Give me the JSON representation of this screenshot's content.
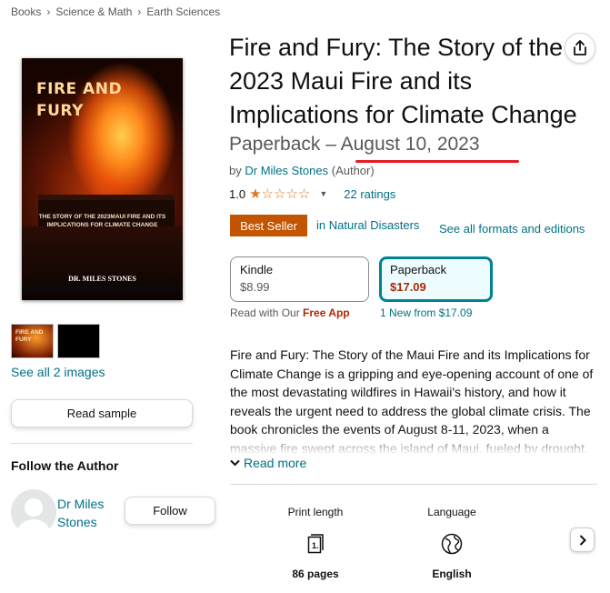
{
  "breadcrumb": [
    "Books",
    "Science & Math",
    "Earth Sciences"
  ],
  "book": {
    "title": "Fire and Fury: The Story of the 2023 Maui Fire and its Implications for Climate Change",
    "format_date": "Paperback – August 10, 2023",
    "by_prefix": "by",
    "author": "Dr Miles Stones",
    "author_role": "(Author)"
  },
  "cover": {
    "title": "FIRE AND\nFURY",
    "subtitle": "THE STORY OF THE 2023MAUI FIRE AND ITS IMPLICATIONS FOR CLIMATE CHANGE",
    "author": "DR. MILES STONES",
    "thumb_title": "FIRE AND\nFURY"
  },
  "rating": {
    "value": "1.0",
    "stars": 1,
    "max_stars": 5,
    "count_label": "22 ratings"
  },
  "badge": {
    "label": "Best Seller",
    "category": "in Natural Disasters"
  },
  "see_formats": "See all formats and editions",
  "formats": [
    {
      "name": "Kindle",
      "price": "$8.99",
      "selected": false
    },
    {
      "name": "Paperback",
      "price": "$17.09",
      "selected": true
    }
  ],
  "format_notes": {
    "kindle_prefix": "Read with Our",
    "kindle_app": "Free App",
    "paperback_new": "1 New",
    "paperback_from": "from $17.09"
  },
  "gallery": {
    "see_images": "See all 2 images"
  },
  "read_sample": "Read sample",
  "follow": {
    "title": "Follow the Author",
    "author_name": "Dr Miles Stones",
    "button": "Follow"
  },
  "description": "Fire and Fury: The Story of the Maui Fire and its Implications for Climate Change is a gripping and eye-opening account of one of the most devastating wildfires in Hawaii's history, and how it reveals the urgent need to address the global climate crisis. The book chronicles the events of August 8-11, 2023, when a massive fire swept across the island of Maui, fueled by drought,",
  "read_more": "Read more",
  "details": [
    {
      "label": "Print length",
      "value": "86 pages",
      "icon": "book-pages-icon"
    },
    {
      "label": "Language",
      "value": "English",
      "icon": "globe-icon"
    }
  ],
  "colors": {
    "link": "#007185",
    "badge": "#c45500",
    "price": "#b12704",
    "selected_border": "#008296",
    "underline": "#e31b23",
    "star": "#de7921"
  }
}
